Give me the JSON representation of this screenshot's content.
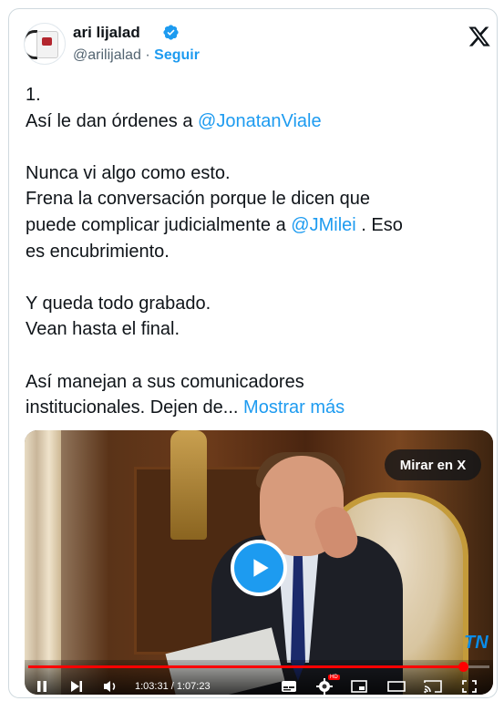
{
  "author": {
    "name": "ari lijalad",
    "handle": "@arilijalad",
    "separator": " · ",
    "follow_label": "Seguir",
    "verified": true
  },
  "icons": {
    "close": "x-logo-icon",
    "verified": "verified-badge-icon",
    "play": "play-icon"
  },
  "tweet": {
    "lines": [
      [
        {
          "t": "1."
        }
      ],
      [
        {
          "t": "Así le dan órdenes a "
        },
        {
          "t": "@JonatanViale",
          "link": true
        }
      ],
      [
        {
          "t": ""
        }
      ],
      [
        {
          "t": "Nunca vi algo como esto."
        }
      ],
      [
        {
          "t": "Frena la conversación porque le dicen que"
        }
      ],
      [
        {
          "t": "puede complicar judicialmente a "
        },
        {
          "t": "@JMilei",
          "link": true
        },
        {
          "t": " . Eso"
        }
      ],
      [
        {
          "t": "es encubrimiento."
        }
      ],
      [
        {
          "t": ""
        }
      ],
      [
        {
          "t": "Y queda todo grabado."
        }
      ],
      [
        {
          "t": "Vean hasta el final."
        }
      ],
      [
        {
          "t": ""
        }
      ],
      [
        {
          "t": "Así manejan a sus comunicadores"
        }
      ],
      [
        {
          "t": "institucionales. Dejen de... "
        },
        {
          "t": "Mostrar más",
          "link": true
        }
      ]
    ]
  },
  "video": {
    "watch_on_x_label": "Mirar en X",
    "channel_logo": "TN",
    "current_time": "1:03:31",
    "duration": "1:07:23",
    "time_display": "1:03:31 / 1:07:23",
    "progress_fraction": 0.943,
    "hd_badge": "HD"
  },
  "colors": {
    "accent": "#1d9bf0",
    "progress": "#ff0000",
    "text": "#0f1419",
    "muted": "#536471"
  }
}
